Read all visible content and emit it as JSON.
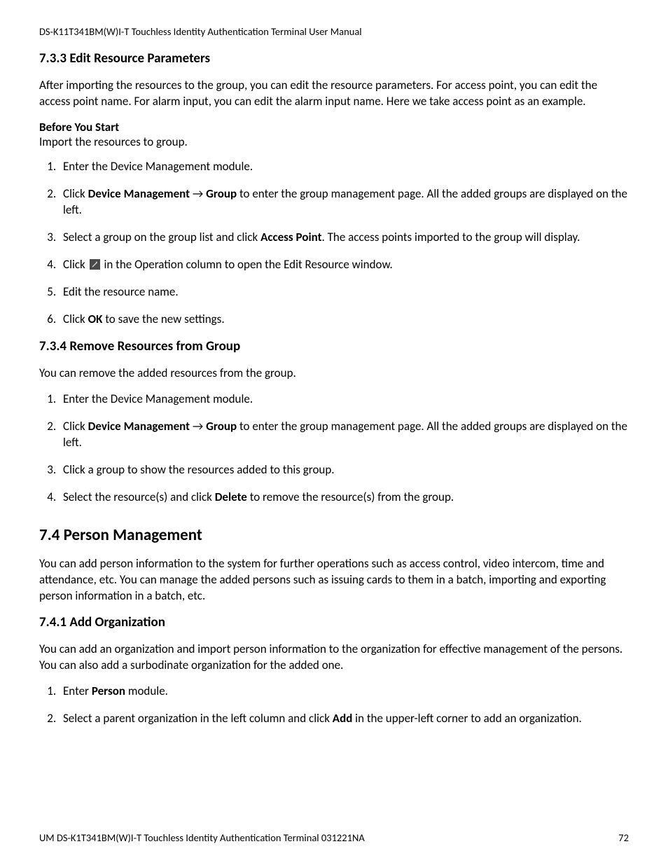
{
  "header": "DS-K11T341BM(W)I-T Touchless Identity Authentication Terminal User Manual",
  "s733": {
    "title": "7.3.3 Edit Resource Parameters",
    "intro": "After importing the resources to the group, you can edit the resource parameters. For access point, you can edit the access point name. For alarm input, you can edit the alarm input name. Here we take access point as an example.",
    "bys_label": "Before You Start",
    "bys_text": "Import the resources to group.",
    "steps": {
      "s1": "Enter the Device Management module.",
      "s2a": "Click ",
      "s2b": "Device Management",
      "s2arrow": " → ",
      "s2c": "Group",
      "s2d": " to enter the group management page. All the added groups are displayed on the left.",
      "s3a": "Select a group on the group list and click ",
      "s3b": "Access Point",
      "s3c": ". The access points imported to the group will display.",
      "s4a": "Click ",
      "s4b": " in the Operation column to open the Edit Resource window.",
      "s5": "Edit the resource name.",
      "s6a": "Click ",
      "s6b": "OK",
      "s6c": " to save the new settings."
    }
  },
  "s734": {
    "title": "7.3.4 Remove Resources from Group",
    "intro": "You can remove the added resources from the group.",
    "steps": {
      "s1": "Enter the Device Management module.",
      "s2a": "Click ",
      "s2b": "Device Management",
      "s2arrow": " → ",
      "s2c": "Group",
      "s2d": " to enter the group management page. All the added groups are displayed on the left.",
      "s3": "Click a group to show the resources added to this group.",
      "s4a": "Select the resource(s) and click ",
      "s4b": "Delete",
      "s4c": " to remove the resource(s) from the group."
    }
  },
  "s74": {
    "title": "7.4 Person Management",
    "intro": "You can add person information to the system for further operations such as access control, video intercom, time and attendance, etc. You can manage the added persons such as issuing cards to them in a batch, importing and exporting person information in a batch, etc."
  },
  "s741": {
    "title": "7.4.1 Add Organization",
    "intro": "You can add an organization and import person information to the organization for effective management of the persons. You can also add a surbodinate organization for the added one.",
    "steps": {
      "s1a": "Enter ",
      "s1b": "Person",
      "s1c": " module.",
      "s2a": "Select a parent organization in the left column and click ",
      "s2b": "Add",
      "s2c": " in the upper-left corner to add an organization."
    }
  },
  "footer": {
    "left": "UM DS-K1T341BM(W)I-T Touchless Identity Authentication Terminal 031221NA",
    "right": "72"
  }
}
